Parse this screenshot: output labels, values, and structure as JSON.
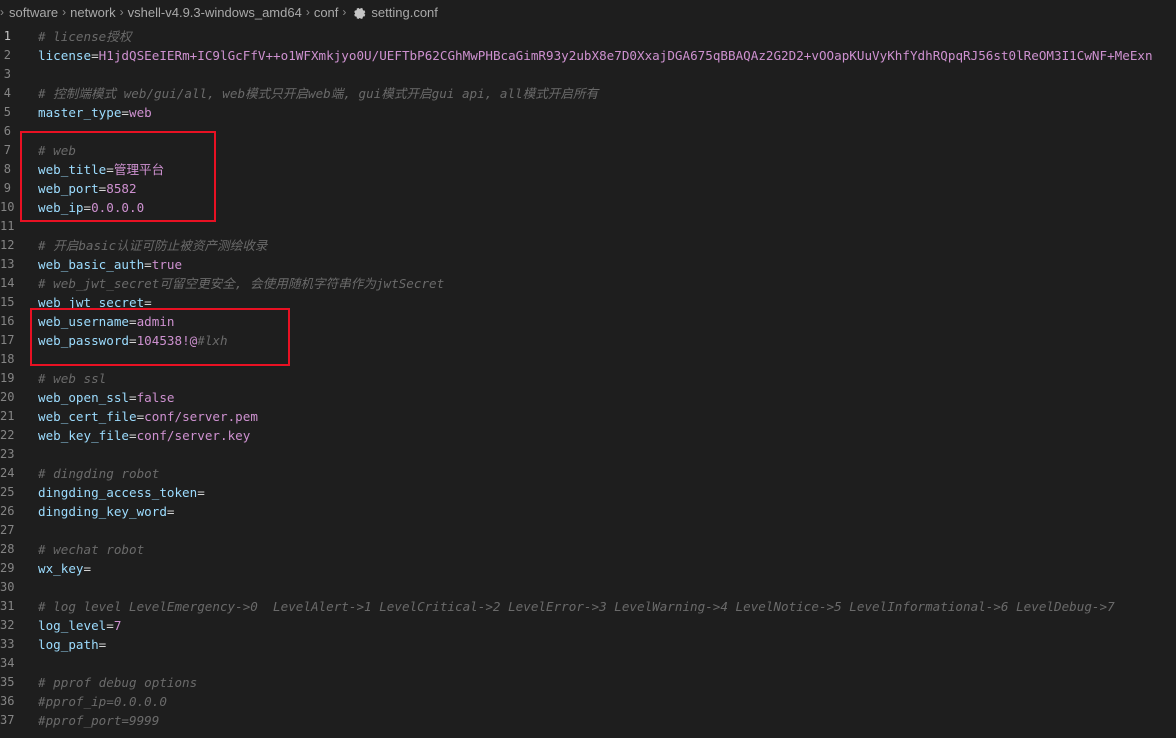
{
  "breadcrumb": {
    "items": [
      "software",
      "network",
      "vshell-v4.9.3-windows_amd64",
      "conf",
      "setting.conf"
    ]
  },
  "colors": {
    "background": "#1e1e1e",
    "comment": "#6a6a6a",
    "key": "#9cdcfe",
    "value": "#ce91d0",
    "highlight_box": "#e81123"
  },
  "lines": [
    {
      "n": "1",
      "type": "comment",
      "text": "# license授权"
    },
    {
      "n": "2",
      "type": "kv",
      "key": "license",
      "value": "H1jdQSEeIERm+IC9lGcFfV++o1WFXmkjyo0U/UEFTbP62CGhMwPHBcaGimR93y2ubX8e7D0XxajDGA675qBBAQAz2G2D2+vOOapKUuVyKhfYdhRQpqRJ56st0lReOM3I1CwNF+MeExn"
    },
    {
      "n": "3",
      "type": "blank"
    },
    {
      "n": "4",
      "type": "comment",
      "text": "# 控制端模式 web/gui/all, web模式只开启web端, gui模式开启gui api, all模式开启所有"
    },
    {
      "n": "5",
      "type": "kv",
      "key": "master_type",
      "value": "web"
    },
    {
      "n": "6",
      "type": "blank"
    },
    {
      "n": "7",
      "type": "comment",
      "text": "# web"
    },
    {
      "n": "8",
      "type": "kv",
      "key": "web_title",
      "value": "管理平台"
    },
    {
      "n": "9",
      "type": "kv",
      "key": "web_port",
      "value": "8582"
    },
    {
      "n": "10",
      "type": "kv",
      "key": "web_ip",
      "value": "0.0.0.0"
    },
    {
      "n": "11",
      "type": "blank"
    },
    {
      "n": "12",
      "type": "comment",
      "text": "# 开启basic认证可防止被资产测绘收录"
    },
    {
      "n": "13",
      "type": "kv",
      "key": "web_basic_auth",
      "value": "true"
    },
    {
      "n": "14",
      "type": "comment",
      "text": "# web_jwt_secret可留空更安全, 会使用随机字符串作为jwtSecret"
    },
    {
      "n": "15",
      "type": "kv",
      "key": "web_jwt_secret",
      "value": ""
    },
    {
      "n": "16",
      "type": "kv",
      "key": "web_username",
      "value": "admin"
    },
    {
      "n": "17",
      "type": "kvc",
      "key": "web_password",
      "value": "104538!@",
      "comment": "#lxh"
    },
    {
      "n": "18",
      "type": "blank"
    },
    {
      "n": "19",
      "type": "comment",
      "text": "# web ssl"
    },
    {
      "n": "20",
      "type": "kv",
      "key": "web_open_ssl",
      "value": "false"
    },
    {
      "n": "21",
      "type": "kv",
      "key": "web_cert_file",
      "value": "conf/server.pem"
    },
    {
      "n": "22",
      "type": "kv",
      "key": "web_key_file",
      "value": "conf/server.key"
    },
    {
      "n": "23",
      "type": "blank"
    },
    {
      "n": "24",
      "type": "comment",
      "text": "# dingding robot"
    },
    {
      "n": "25",
      "type": "kv",
      "key": "dingding_access_token",
      "value": ""
    },
    {
      "n": "26",
      "type": "kv",
      "key": "dingding_key_word",
      "value": ""
    },
    {
      "n": "27",
      "type": "blank"
    },
    {
      "n": "28",
      "type": "comment",
      "text": "# wechat robot"
    },
    {
      "n": "29",
      "type": "kv",
      "key": "wx_key",
      "value": ""
    },
    {
      "n": "30",
      "type": "blank"
    },
    {
      "n": "31",
      "type": "comment",
      "text": "# log level LevelEmergency->0  LevelAlert->1 LevelCritical->2 LevelError->3 LevelWarning->4 LevelNotice->5 LevelInformational->6 LevelDebug->7"
    },
    {
      "n": "32",
      "type": "kv",
      "key": "log_level",
      "value": "7"
    },
    {
      "n": "33",
      "type": "kv",
      "key": "log_path",
      "value": ""
    },
    {
      "n": "34",
      "type": "blank"
    },
    {
      "n": "35",
      "type": "comment",
      "text": "# pprof debug options"
    },
    {
      "n": "36",
      "type": "comment",
      "text": "#pprof_ip=0.0.0.0"
    },
    {
      "n": "37",
      "type": "comment",
      "text": "#pprof_port=9999"
    }
  ]
}
